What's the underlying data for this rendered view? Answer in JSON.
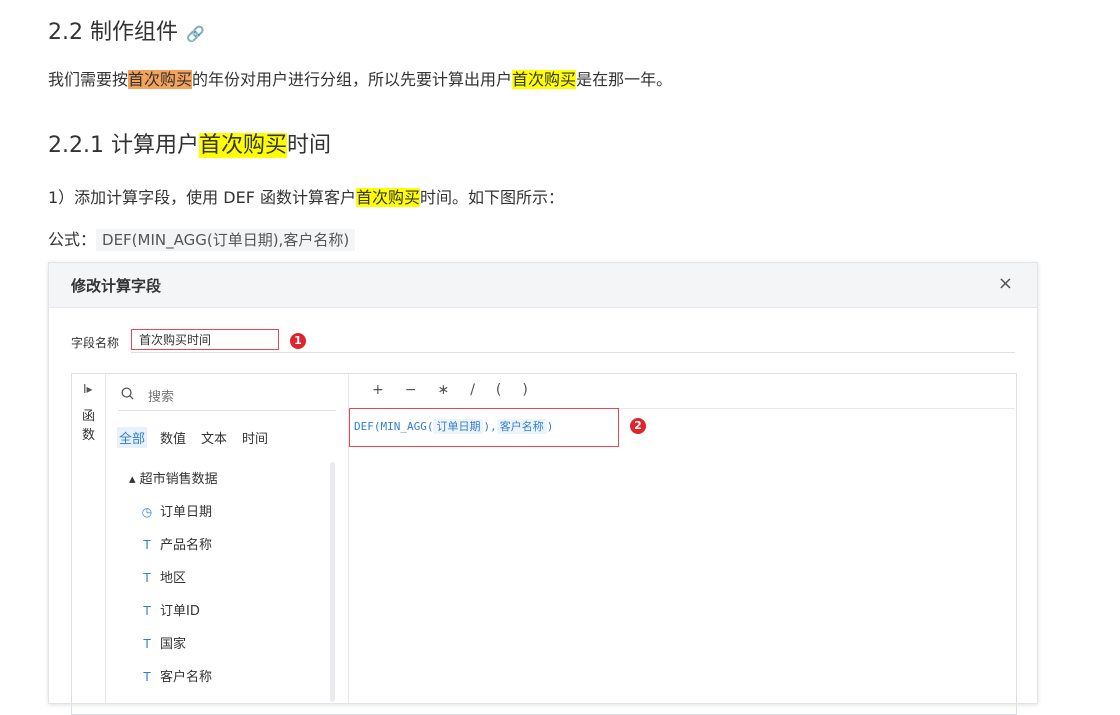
{
  "section": {
    "heading": "2.2 制作组件",
    "link_icon": "link-icon",
    "intro_pre": "我们需要按",
    "intro_hl1": "首次购买",
    "intro_mid": "的年份对用户进行分组，所以先要计算出用户",
    "intro_hl2": "首次购买",
    "intro_post": "是在那一年。"
  },
  "subsection": {
    "heading_pre": "2.2.1 计算用户",
    "heading_hl": "首次购买",
    "heading_post": "时间",
    "step_pre": "1）添加计算字段，使用 DEF 函数计算客户",
    "step_hl": "首次购买",
    "step_post": "时间。如下图所示：",
    "formula_label": "公式：",
    "formula_code": "DEF(MIN_AGG(订单日期),客户名称)"
  },
  "dialog": {
    "title": "修改计算字段",
    "close": "×",
    "field_label": "字段名称",
    "field_value": "首次购买时间",
    "badge1": "1",
    "badge2": "2",
    "rail_arrow": "I▸",
    "rail_text": "函数",
    "search_placeholder": "搜索",
    "tabs": [
      "全部",
      "数值",
      "文本",
      "时间"
    ],
    "tree_root": "▴ 超市销售数据",
    "fields": [
      {
        "icon": "◷",
        "label": "订单日期"
      },
      {
        "icon": "T",
        "label": "产品名称"
      },
      {
        "icon": "T",
        "label": "地区"
      },
      {
        "icon": "T",
        "label": "订单ID"
      },
      {
        "icon": "T",
        "label": "国家"
      },
      {
        "icon": "T",
        "label": "客户名称"
      }
    ],
    "operators": [
      "+",
      "−",
      "∗",
      "/",
      "(",
      ")"
    ],
    "formula_prefix": "DEF(MIN_AGG(",
    "formula_tok1": "订单日期",
    "formula_sep": "),",
    "formula_tok2": "客户名称",
    "formula_suffix": ")"
  },
  "colors": {
    "highlight_orange": "#f5a35a",
    "highlight_yellow": "#ffff00",
    "accent_blue": "#2f80d1",
    "annotation_red": "#e8474c"
  }
}
